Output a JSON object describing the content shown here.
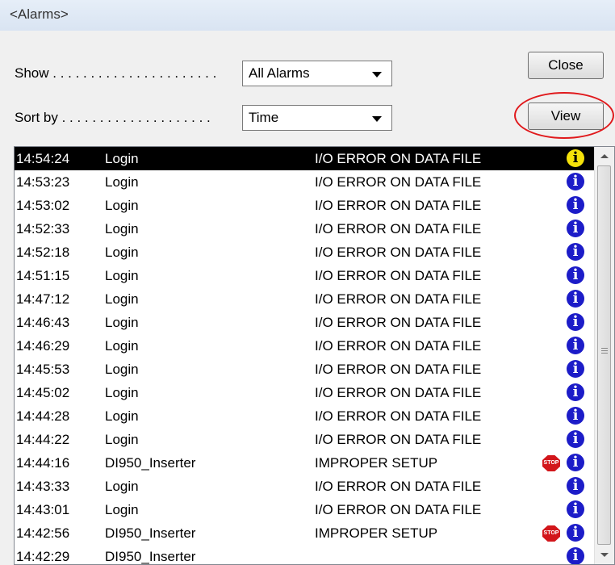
{
  "window": {
    "title": "<Alarms>"
  },
  "controls": {
    "show_label": "Show . . . . . . . . . . . . . . . . . . . . . .",
    "show_value": "All Alarms",
    "sort_label": "Sort by . . . . . . . . . . . . . . . . . . . .",
    "sort_value": "Time",
    "close_label": "Close",
    "view_label": "View"
  },
  "alarms": [
    {
      "time": "14:54:24",
      "source": "Login",
      "message": "I/O ERROR ON DATA FILE",
      "stop": false,
      "selected": true
    },
    {
      "time": "14:53:23",
      "source": "Login",
      "message": "I/O ERROR ON DATA FILE",
      "stop": false
    },
    {
      "time": "14:53:02",
      "source": "Login",
      "message": "I/O ERROR ON DATA FILE",
      "stop": false
    },
    {
      "time": "14:52:33",
      "source": "Login",
      "message": "I/O ERROR ON DATA FILE",
      "stop": false
    },
    {
      "time": "14:52:18",
      "source": "Login",
      "message": "I/O ERROR ON DATA FILE",
      "stop": false
    },
    {
      "time": "14:51:15",
      "source": "Login",
      "message": "I/O ERROR ON DATA FILE",
      "stop": false
    },
    {
      "time": "14:47:12",
      "source": "Login",
      "message": "I/O ERROR ON DATA FILE",
      "stop": false
    },
    {
      "time": "14:46:43",
      "source": "Login",
      "message": "I/O ERROR ON DATA FILE",
      "stop": false
    },
    {
      "time": "14:46:29",
      "source": "Login",
      "message": "I/O ERROR ON DATA FILE",
      "stop": false
    },
    {
      "time": "14:45:53",
      "source": "Login",
      "message": "I/O ERROR ON DATA FILE",
      "stop": false
    },
    {
      "time": "14:45:02",
      "source": "Login",
      "message": "I/O ERROR ON DATA FILE",
      "stop": false
    },
    {
      "time": "14:44:28",
      "source": "Login",
      "message": "I/O ERROR ON DATA FILE",
      "stop": false
    },
    {
      "time": "14:44:22",
      "source": "Login",
      "message": "I/O ERROR ON DATA FILE",
      "stop": false
    },
    {
      "time": "14:44:16",
      "source": "DI950_Inserter",
      "message": "IMPROPER SETUP",
      "stop": true
    },
    {
      "time": "14:43:33",
      "source": "Login",
      "message": "I/O ERROR ON DATA FILE",
      "stop": false
    },
    {
      "time": "14:43:01",
      "source": "Login",
      "message": "I/O ERROR ON DATA FILE",
      "stop": false
    },
    {
      "time": "14:42:56",
      "source": "DI950_Inserter",
      "message": "IMPROPER SETUP",
      "stop": true
    },
    {
      "time": "14:42:29",
      "source": "DI950_Inserter",
      "message": "",
      "stop": false
    }
  ],
  "icons": {
    "info": "info-icon",
    "stop": "stop-sign-icon",
    "info_glyph": "i",
    "stop_glyph": "STOP"
  },
  "colors": {
    "info_blue": "#1c1cc8",
    "info_selected_yellow": "#f5e20a",
    "stop_red": "#d2161b",
    "highlight_circle": "#e0191c"
  }
}
